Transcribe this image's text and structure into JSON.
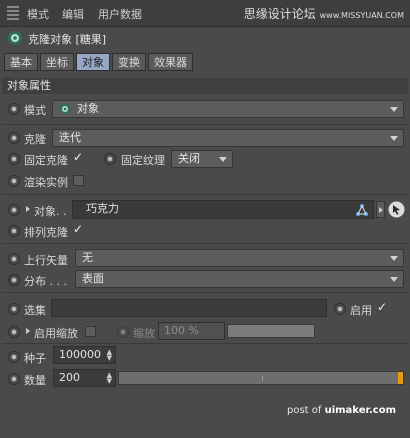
{
  "menu": {
    "items": [
      "模式",
      "编辑",
      "用户数据"
    ],
    "watermark": "思缘设计论坛",
    "watermark_url": "www.MISSYUAN.COM"
  },
  "object": {
    "name": "克隆对象 [糖果]"
  },
  "tabs": [
    {
      "label": "基本",
      "active": false
    },
    {
      "label": "坐标",
      "active": false
    },
    {
      "label": "对象",
      "active": true
    },
    {
      "label": "变换",
      "active": false
    },
    {
      "label": "效果器",
      "active": false
    }
  ],
  "section": {
    "title": "对象属性"
  },
  "props": {
    "mode_label": "模式",
    "mode_value": "对象",
    "clone_label": "克隆",
    "clone_value": "迭代",
    "fixclone_label": "固定克隆",
    "fixclone_checked": "✓",
    "fixtexture_label": "固定纹理",
    "fixtexture_value": "关闭",
    "render_label": "渲染实例",
    "object_label": "对象. .",
    "object_value": "巧克力",
    "arrange_label": "排列克隆",
    "arrange_checked": "✓",
    "upvector_label": "上行矢量",
    "upvector_value": "无",
    "distribution_label": "分布 . . .",
    "distribution_value": "表面",
    "selection_label": "选集",
    "selection_value": "",
    "enable_label": "启用",
    "enable_checked": "✓",
    "enable_scale_label": "启用缩放",
    "scale_label": "缩放",
    "scale_value": "100 %",
    "seed_label": "种子",
    "seed_value": "100000",
    "count_label": "数量",
    "count_value": "200"
  },
  "footer": {
    "prefix": "post of ",
    "site": "uimaker.com"
  },
  "colors": {
    "accent": "#e59a18",
    "tab_active": "#96a8c6"
  }
}
